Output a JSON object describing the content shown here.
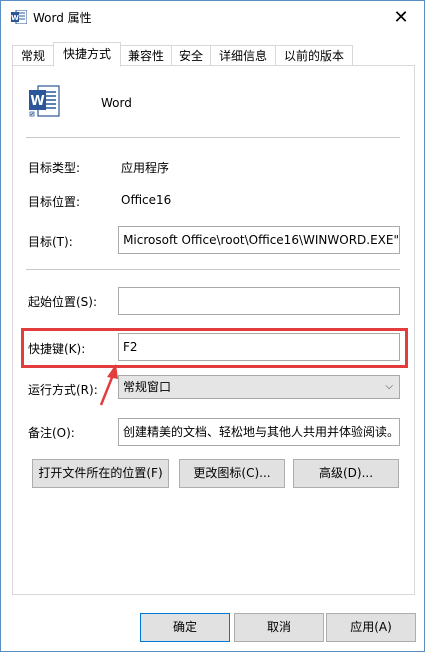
{
  "window": {
    "title": "Word 属性",
    "close_glyph": "✕"
  },
  "tabs": [
    {
      "label": "常规",
      "active": false
    },
    {
      "label": "快捷方式",
      "active": true
    },
    {
      "label": "兼容性",
      "active": false
    },
    {
      "label": "安全",
      "active": false
    },
    {
      "label": "详细信息",
      "active": false
    },
    {
      "label": "以前的版本",
      "active": false
    }
  ],
  "app": {
    "name": "Word",
    "icon": "word-icon",
    "brand_color": "#2b579a"
  },
  "fields": {
    "target_type_label": "目标类型:",
    "target_type_value": "应用程序",
    "target_location_label": "目标位置:",
    "target_location_value": "Office16",
    "target_label": "目标(T):",
    "target_value": "Microsoft Office\\root\\Office16\\WINWORD.EXE\"",
    "start_in_label": "起始位置(S):",
    "start_in_value": "",
    "shortcut_key_label": "快捷键(K):",
    "shortcut_key_value": "F2",
    "run_label": "运行方式(R):",
    "run_value": "常规窗口",
    "comment_label": "备注(O):",
    "comment_value": "创建精美的文档、轻松地与其他人共用并体验阅读。"
  },
  "actions": {
    "open_location": "打开文件所在的位置(F)",
    "change_icon": "更改图标(C)...",
    "advanced": "高级(D)..."
  },
  "footer": {
    "ok": "确定",
    "cancel": "取消",
    "apply": "应用(A)"
  },
  "colors": {
    "highlight": "#e23c3c"
  }
}
